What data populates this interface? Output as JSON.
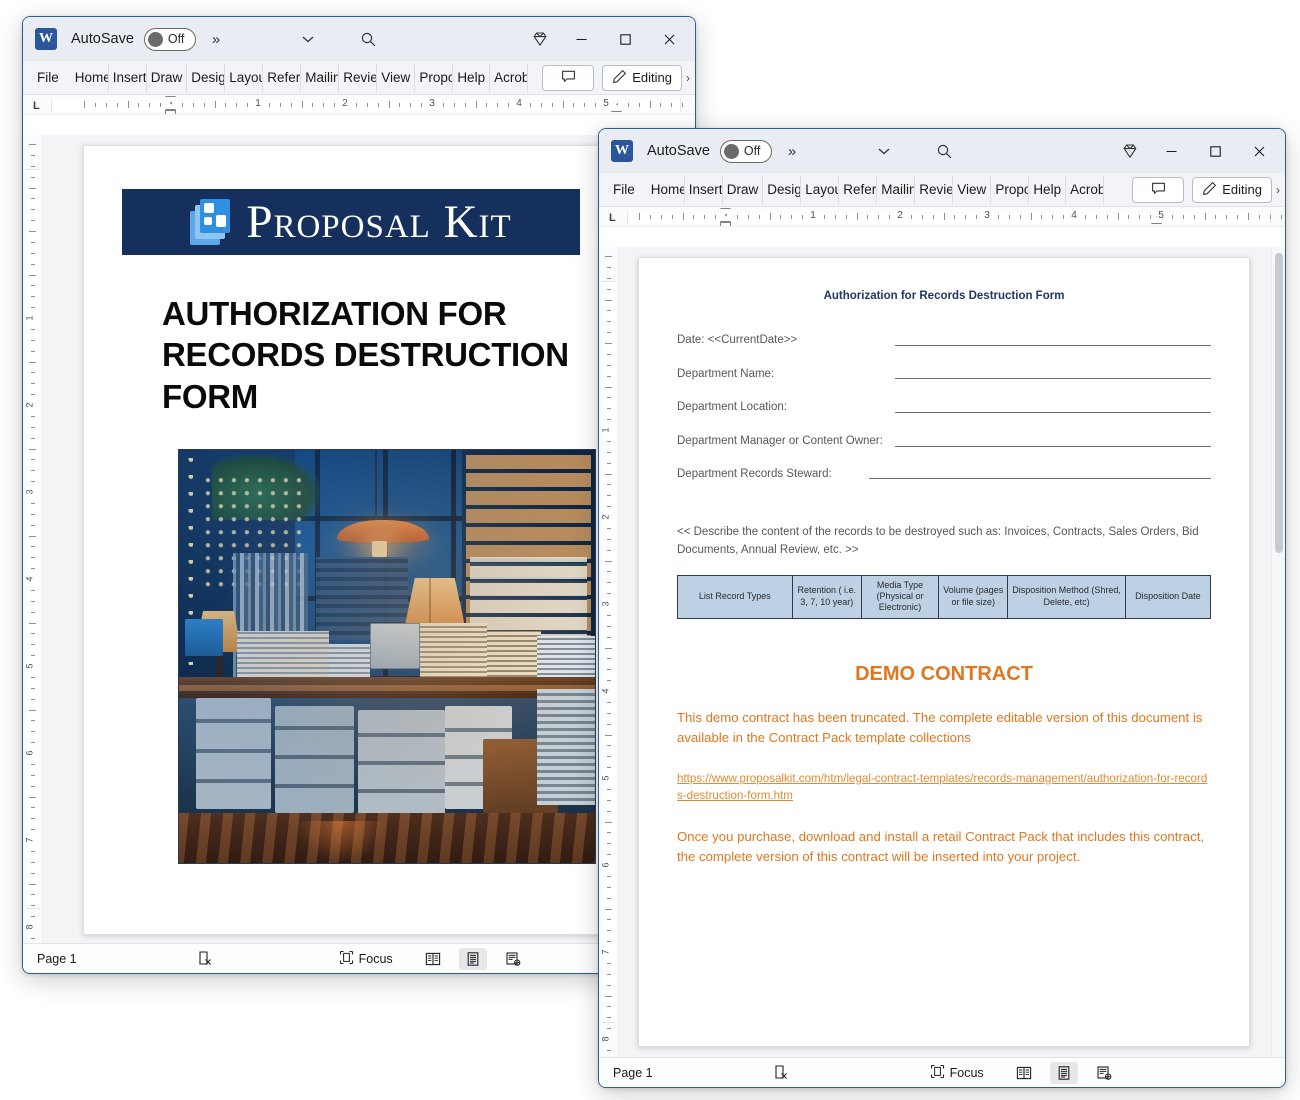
{
  "window1": {
    "titlebar": {
      "app_logo": "word-logo",
      "autosave_label": "AutoSave",
      "autosave_state": "Off",
      "overflow": "»",
      "chevron_icon": "chevron-down-icon",
      "search_icon": "search-icon",
      "copilot_icon": "diamond-icon",
      "minimize": "─",
      "maximize": "□",
      "close": "✕"
    },
    "ribbon": {
      "tabs": [
        "File",
        "Home",
        "Insert",
        "Draw",
        "Design",
        "Layout",
        "References",
        "Mailings",
        "Review",
        "View",
        "Proposal Kit",
        "Help",
        "Acrobat"
      ],
      "comment_icon": "comment-icon",
      "editing_label": "Editing",
      "editing_icon": "pencil-icon",
      "expand_caret": "›"
    },
    "ruler": {
      "h_numbers": [
        "1",
        "2",
        "3",
        "4",
        "5"
      ],
      "v_numbers": [
        "1",
        "2",
        "3",
        "4",
        "5",
        "6",
        "7",
        "8"
      ],
      "tab_stop": "L"
    },
    "document": {
      "brand": "Proposal Kit",
      "brand_logo": "proposal-kit-logo",
      "heading": "AUTHORIZATION FOR RECORDS DESTRUCTION FORM",
      "photo_alt": "records-archive-office-photo"
    },
    "statusbar": {
      "page": "Page 1",
      "proofing_icon": "proofing-errors-icon",
      "focus_label": "Focus",
      "focus_icon": "focus-icon",
      "view_read": "read-mode-icon",
      "view_print": "print-layout-icon",
      "view_web": "web-layout-icon",
      "selected_view": "print-layout-icon"
    }
  },
  "window2": {
    "titlebar": {
      "app_logo": "word-logo",
      "autosave_label": "AutoSave",
      "autosave_state": "Off",
      "overflow": "»",
      "chevron_icon": "chevron-down-icon",
      "search_icon": "search-icon",
      "copilot_icon": "diamond-icon",
      "minimize": "─",
      "maximize": "□",
      "close": "✕"
    },
    "ribbon": {
      "tabs": [
        "File",
        "Home",
        "Insert",
        "Draw",
        "Design",
        "Layout",
        "References",
        "Mailings",
        "Review",
        "View",
        "Proposal Kit",
        "Help",
        "Acrobat"
      ],
      "comment_icon": "comment-icon",
      "editing_label": "Editing",
      "editing_icon": "pencil-icon",
      "expand_caret": "›"
    },
    "ruler": {
      "h_numbers": [
        "1",
        "2",
        "3",
        "4",
        "5"
      ],
      "v_numbers": [
        "1",
        "2",
        "3",
        "4",
        "5",
        "6",
        "7",
        "8"
      ],
      "tab_stop": "L"
    },
    "document": {
      "title": "Authorization for Records Destruction Form",
      "fields": [
        {
          "label": "Date: <<CurrentDate>>",
          "value": ""
        },
        {
          "label": "Department Name:",
          "value": ""
        },
        {
          "label": "Department Location:",
          "value": ""
        },
        {
          "label": "Department Manager or Content Owner:",
          "value": ""
        },
        {
          "label": "Department Records Steward:",
          "value": ""
        }
      ],
      "instruction": "<< Describe the content of the records to be destroyed such as: Invoices, Contracts, Sales Orders, Bid Documents, Annual Review, etc. >>",
      "table_headers": [
        "List Record Types",
        "Retention ( i.e. 3, 7, 10 year)",
        "Media Type (Physical or Electronic)",
        "Volume (pages or file size)",
        "Disposition Method (Shred, Delete, etc)",
        "Disposition Date"
      ],
      "demo_heading": "DEMO CONTRACT",
      "demo_paragraph_1": "This demo contract has been truncated. The complete editable version of this document is available in the Contract Pack template collections",
      "demo_link": "https://www.proposalkit.com/htm/legal-contract-templates/records-management/authorization-for-records-destruction-form.htm",
      "demo_paragraph_2": "Once you purchase, download and install a retail Contract Pack that includes this contract, the complete version of this contract will be inserted into your project."
    },
    "statusbar": {
      "page": "Page 1",
      "proofing_icon": "proofing-errors-icon",
      "focus_label": "Focus",
      "focus_icon": "focus-icon",
      "view_read": "read-mode-icon",
      "view_print": "print-layout-icon",
      "view_web": "web-layout-icon",
      "selected_view": "print-layout-icon"
    }
  },
  "colors": {
    "brand_navy": "#16305e",
    "accent_orange": "#e0761f",
    "link_orange": "#e08a33",
    "table_header_blue": "#bdd0e4",
    "doc_title_blue": "#1f3864",
    "window_border": "#2a6099",
    "word_blue": "#2b579a"
  }
}
